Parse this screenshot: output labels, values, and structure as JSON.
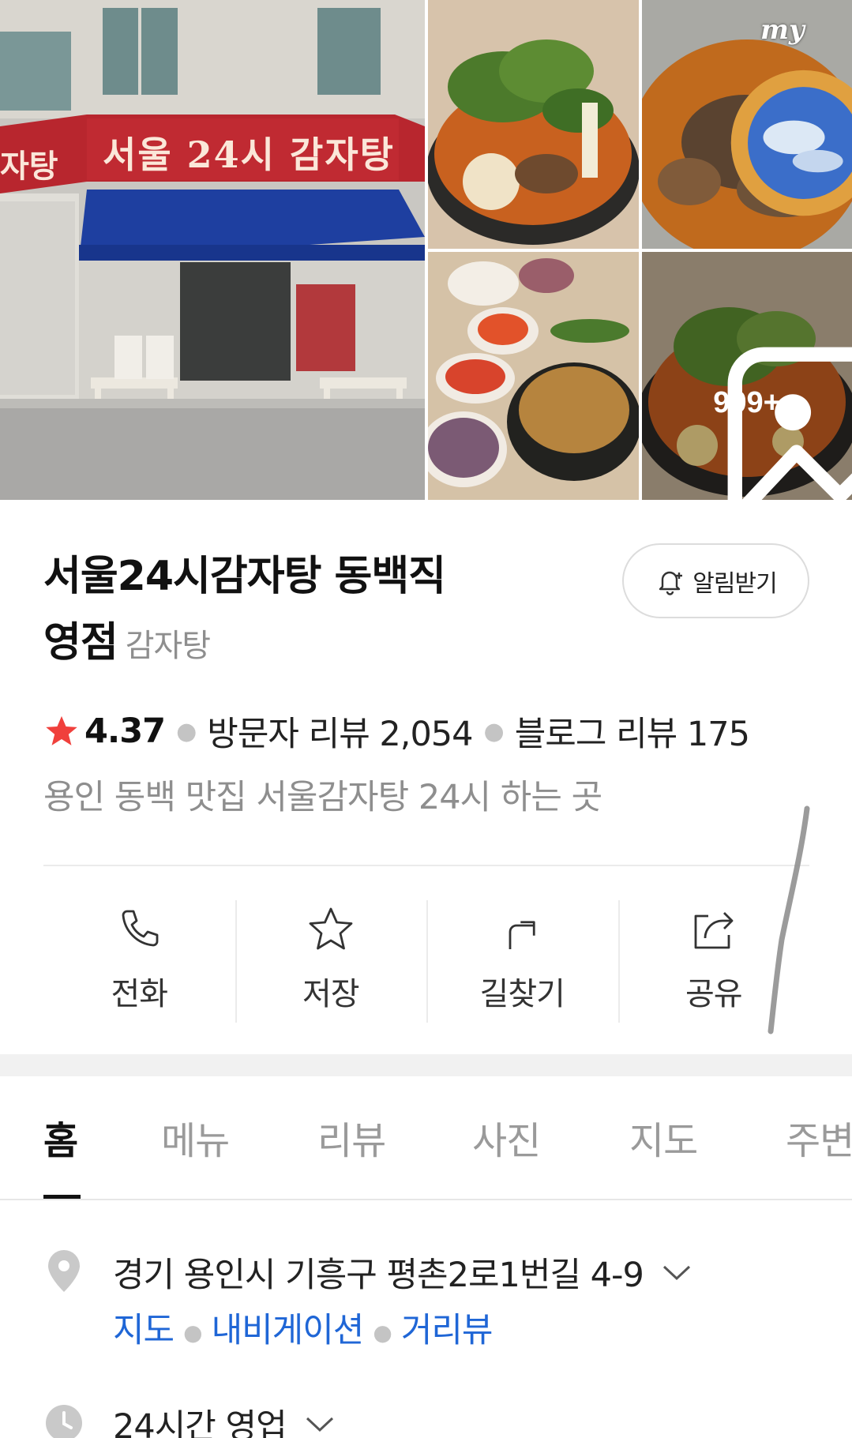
{
  "gallery": {
    "store_sign": "서울 24시 감자탕",
    "store_sign_left": "자탕",
    "more_count": "999+",
    "badge_text": "my"
  },
  "place": {
    "name_line1": "서울24시감자탕 동백직",
    "name_line2": "영점",
    "category": "감자탕",
    "alarm_label": "알림받기",
    "rating": "4.37",
    "visitor_reviews": "방문자 리뷰 2,054",
    "blog_reviews": "블로그 리뷰 175",
    "tagline": "용인 동백 맛집 서울감자탕 24시 하는 곳"
  },
  "actions": [
    {
      "label": "전화",
      "icon": "phone-icon"
    },
    {
      "label": "저장",
      "icon": "star-outline-icon"
    },
    {
      "label": "길찾기",
      "icon": "directions-icon"
    },
    {
      "label": "공유",
      "icon": "share-icon"
    }
  ],
  "tabs": [
    {
      "label": "홈",
      "active": true
    },
    {
      "label": "메뉴"
    },
    {
      "label": "리뷰"
    },
    {
      "label": "사진"
    },
    {
      "label": "지도"
    },
    {
      "label": "주변"
    }
  ],
  "info": {
    "address": "경기 용인시 기흥구 평촌2로1번길 4-9",
    "links": [
      "지도",
      "내비게이션",
      "거리뷰"
    ],
    "hours": "24시간 영업"
  },
  "colors": {
    "star": "#f0403c",
    "link": "#1f66d6",
    "sign_red": "#b8262e",
    "awning_blue": "#1e3fa0"
  }
}
